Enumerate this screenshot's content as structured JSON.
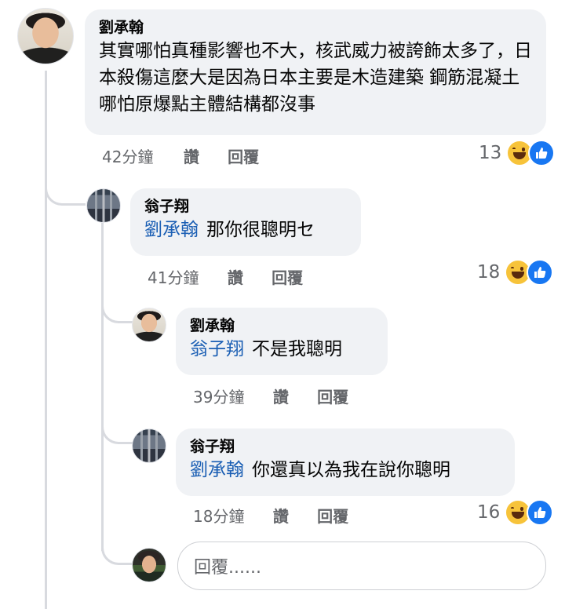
{
  "comments": [
    {
      "author": "劉承翰",
      "mention": "",
      "text": "其實哪怕真種影響也不大，核武威力被誇飾太多了，日本殺傷這麼大是因為日本主要是木造建築 鋼筋混凝土哪怕原爆點主體結構都沒事",
      "time": "42分鐘",
      "like_label": "讚",
      "reply_label": "回覆",
      "reaction_count": "13"
    },
    {
      "author": "翁子翔",
      "mention": "劉承翰",
      "text": "那你很聰明セ",
      "time": "41分鐘",
      "like_label": "讚",
      "reply_label": "回覆",
      "reaction_count": "18"
    },
    {
      "author": "劉承翰",
      "mention": "翁子翔",
      "text": "不是我聰明",
      "time": "39分鐘",
      "like_label": "讚",
      "reply_label": "回覆",
      "reaction_count": ""
    },
    {
      "author": "翁子翔",
      "mention": "劉承翰",
      "text": "你還真以為我在說你聰明",
      "time": "18分鐘",
      "like_label": "讚",
      "reply_label": "回覆",
      "reaction_count": "16"
    }
  ],
  "reply_box": {
    "placeholder": "回覆......"
  },
  "colors": {
    "bubble": "#f0f2f5",
    "mention": "#1b5fb4",
    "meta": "#65676b",
    "like_blue": "#1877f2",
    "haha_yellow": "#f7c33a"
  },
  "icons": [
    "haha-reaction-icon",
    "like-reaction-icon"
  ]
}
